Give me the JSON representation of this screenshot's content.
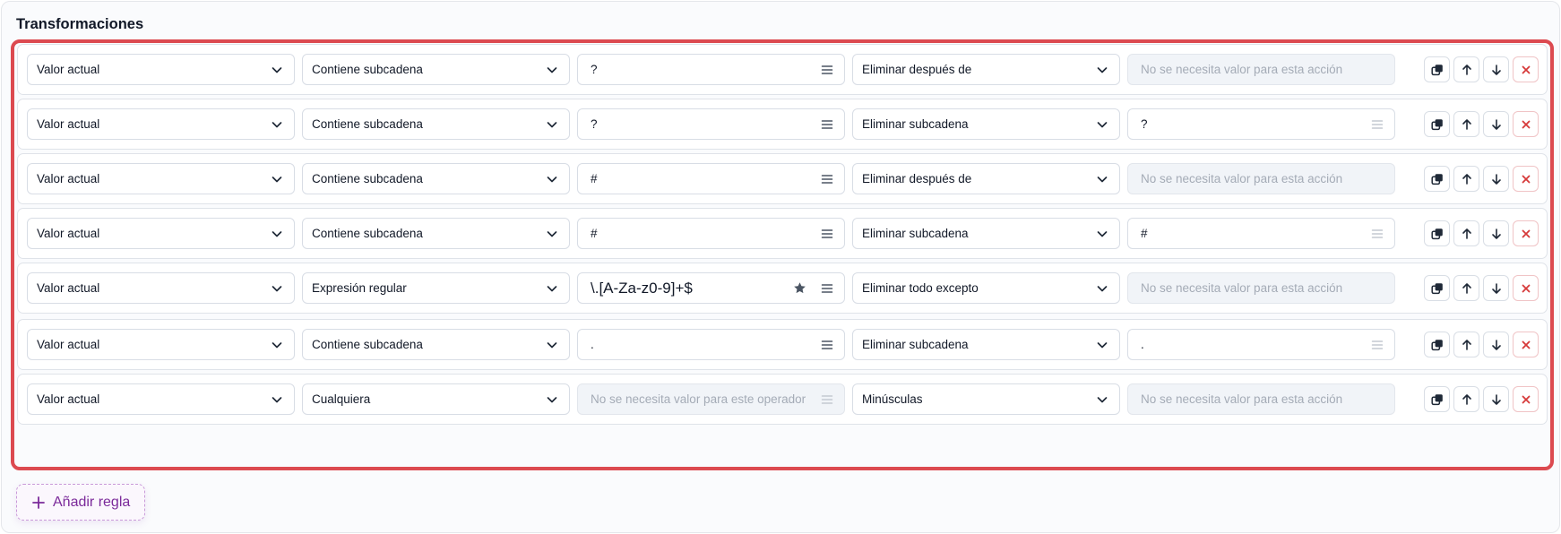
{
  "section": {
    "title": "Transformaciones"
  },
  "rules": [
    {
      "source": "Valor actual",
      "operator": "Contiene subcadena",
      "value": "?",
      "action": "Eliminar después de",
      "argument": "",
      "argument_placeholder": "No se necesita valor para esta acción"
    },
    {
      "source": "Valor actual",
      "operator": "Contiene subcadena",
      "value": "?",
      "action": "Eliminar subcadena",
      "argument": "?",
      "argument_placeholder": ""
    },
    {
      "source": "Valor actual",
      "operator": "Contiene subcadena",
      "value": "#",
      "action": "Eliminar después de",
      "argument": "",
      "argument_placeholder": "No se necesita valor para esta acción"
    },
    {
      "source": "Valor actual",
      "operator": "Contiene subcadena",
      "value": "#",
      "action": "Eliminar subcadena",
      "argument": "#",
      "argument_placeholder": ""
    },
    {
      "source": "Valor actual",
      "operator": "Expresión regular",
      "value": "\\.[A-Za-z0-9]+$",
      "action": "Eliminar todo excepto",
      "argument": "",
      "argument_placeholder": "No se necesita valor para esta acción"
    },
    {
      "source": "Valor actual",
      "operator": "Contiene subcadena",
      "value": ".",
      "action": "Eliminar subcadena",
      "argument": ".",
      "argument_placeholder": ""
    },
    {
      "source": "Valor actual",
      "operator": "Cualquiera",
      "value": "",
      "value_placeholder": "No se necesita valor para este operador",
      "action": "Minúsculas",
      "argument": "",
      "argument_placeholder": "No se necesita valor para esta acción"
    }
  ],
  "add_rule": {
    "label": "Añadir regla"
  },
  "icons": {
    "chevron": "chevron-down-icon",
    "menu": "menu-icon",
    "favorite": "star-icon",
    "duplicate": "duplicate-icon",
    "move_up": "arrow-up-icon",
    "move_down": "arrow-down-icon",
    "delete": "close-icon",
    "add": "plus-icon"
  },
  "colors": {
    "highlight_border": "#dc4a50",
    "delete_accent": "#d63a3a",
    "add_accent": "#7b2a9a"
  }
}
